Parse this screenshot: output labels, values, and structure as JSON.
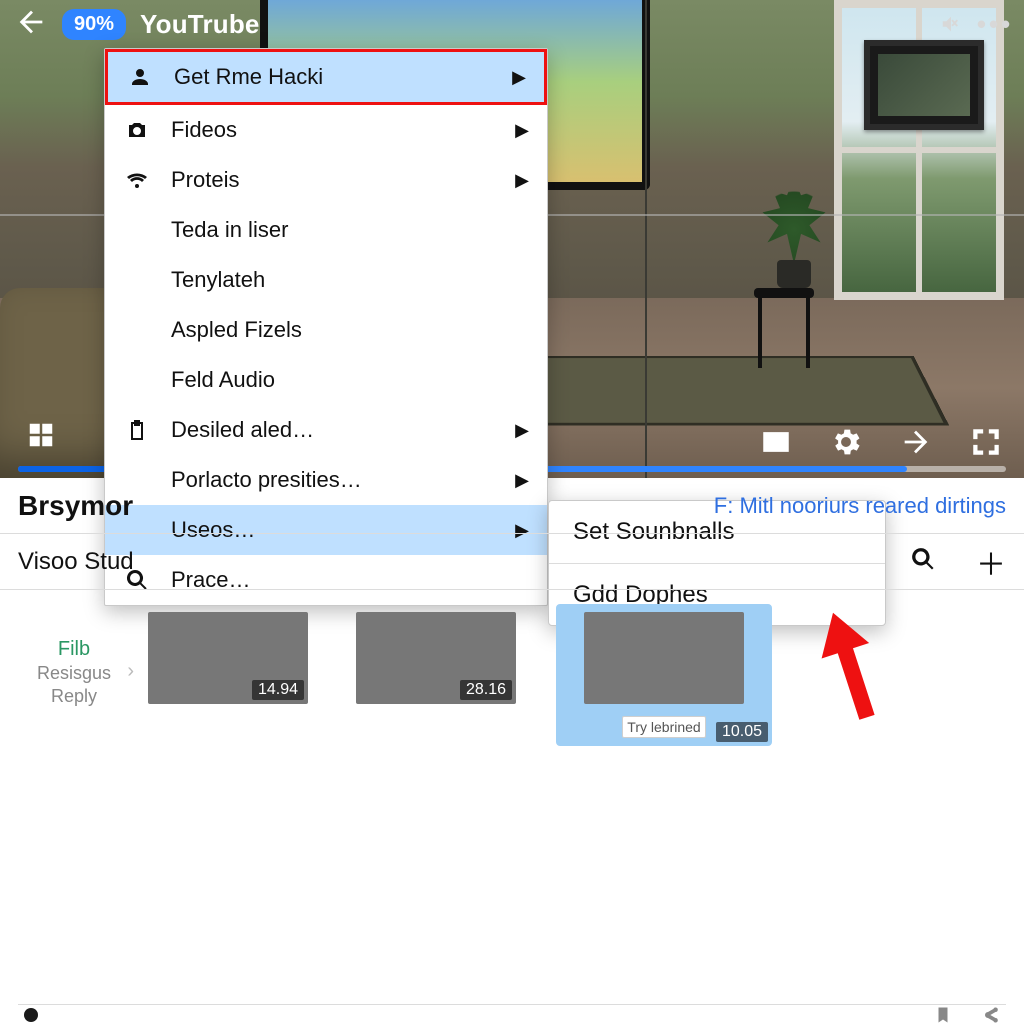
{
  "header": {
    "zoom_badge": "90%",
    "app_title": "YouTrube"
  },
  "menu": {
    "items": [
      {
        "label": "Get Rme Hacki",
        "icon": "person-icon",
        "has_sub": true,
        "state": "highlight"
      },
      {
        "label": "Fideos",
        "icon": "camera-icon",
        "has_sub": true
      },
      {
        "label": "Proteis",
        "icon": "wifi-icon",
        "has_sub": true
      },
      {
        "label": "Teda in liser",
        "has_sub": false
      },
      {
        "label": "Tenylateh",
        "has_sub": false
      },
      {
        "label": "Aspled Fizels",
        "has_sub": false
      },
      {
        "label": "Feld Audio",
        "has_sub": false
      },
      {
        "label": "Desiled aled…",
        "icon": "clipboard-icon",
        "has_sub": true
      },
      {
        "label": "Porlacto presities…",
        "has_sub": true
      },
      {
        "label": "Useos…",
        "has_sub": true,
        "state": "hover"
      },
      {
        "label": "Prace…",
        "icon": "search-icon",
        "has_sub": false
      }
    ]
  },
  "submenu": {
    "items": [
      {
        "label": "Set Sounbnalls"
      },
      {
        "label": "Gdd Dophes"
      }
    ]
  },
  "section": {
    "title": "Brsymor",
    "right_link": "F: Mitl nooriurs reared dirtings"
  },
  "toolbar": {
    "left_label": "Visoo Stud"
  },
  "side_labels": {
    "l1": "Filb",
    "l2": "Resisgus",
    "l3": "Reply"
  },
  "thumbs": [
    {
      "dur": "14.94"
    },
    {
      "dur": "28.16"
    },
    {
      "dur": "10.05",
      "tag": "Try lebrined",
      "selected": true
    }
  ],
  "colors": {
    "accent": "#2f84ff",
    "highlight_border": "#e11",
    "link": "#2f6fe0"
  }
}
